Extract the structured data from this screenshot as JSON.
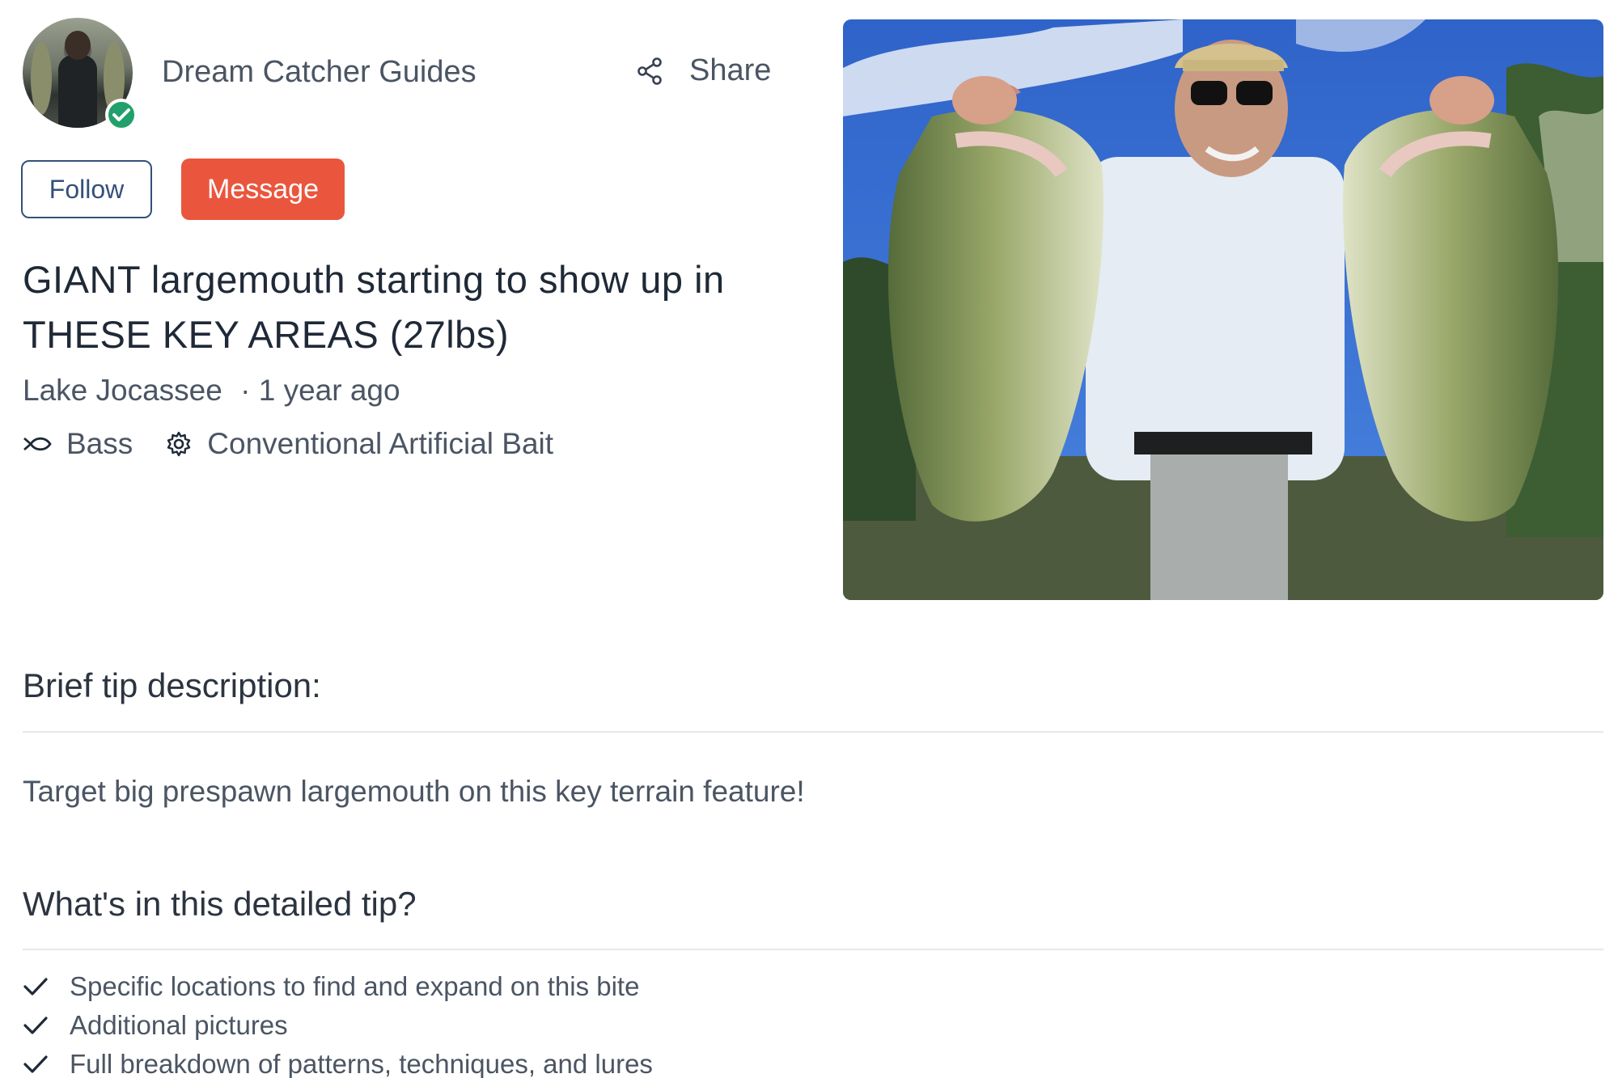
{
  "author": {
    "name": "Dream Catcher Guides",
    "verified": true,
    "share_label": "Share",
    "follow_label": "Follow",
    "message_label": "Message"
  },
  "tip": {
    "title": "GIANT largemouth starting to show up in THESE KEY AREAS (27lbs)",
    "location": "Lake Jocassee",
    "time_ago": "· 1 year ago",
    "species": "Bass",
    "species_icon": "fish-icon",
    "bait": "Conventional Artificial Bait",
    "bait_icon": "gear-icon"
  },
  "brief": {
    "heading": "Brief tip description:",
    "text": "Target big prespawn largemouth on this key terrain feature!"
  },
  "details": {
    "heading": "What's in this detailed tip?",
    "items": [
      "Specific locations to find and expand on this bite",
      "Additional pictures",
      "Full breakdown of patterns, techniques, and lures"
    ]
  },
  "colors": {
    "accent": "#ea563d",
    "follow_border": "#34507a",
    "verified": "#22a06b"
  }
}
